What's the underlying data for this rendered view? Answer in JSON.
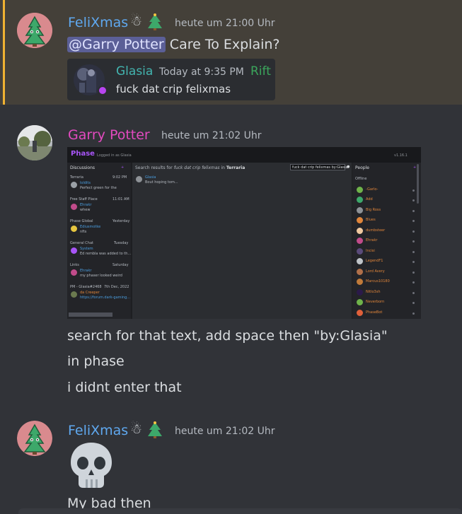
{
  "messages": [
    {
      "author": "FeliXmas",
      "author_color": "#5fa8ef",
      "emoji_icons": [
        "snowman-icon",
        "christmas-tree-icon"
      ],
      "timestamp": "heute um 21:00 Uhr",
      "mention": "@Garry Potter",
      "text": "Care To Explain?",
      "reply": {
        "author": "Glasia",
        "author_color": "#43b5b0",
        "timestamp": "Today at 9:35 PM",
        "tag": "Rift",
        "tag_color": "#3ba55c",
        "text": "fuck dat crip felixmas"
      }
    },
    {
      "author": "Garry Potter",
      "author_color": "#e34ac0",
      "timestamp": "heute um 21:02 Uhr",
      "lines": [
        "search for that text, add  space then \"by:Glasia\"",
        "in phase",
        "i didnt enter that"
      ],
      "attachment": {
        "app": "Phase",
        "logged_in": "Logged in as Glasia",
        "version": "v1.16.1",
        "discussions_label": "Discussions",
        "search_prefix": "Search results for",
        "search_query": "fuck dat crip felixmas",
        "search_in": "in",
        "search_server": "Terraria",
        "search_box": "fuck dat crip felixmas by:Glasia",
        "result_author": "Glasia",
        "result_text": "Bout hoping tom...",
        "people_label": "People",
        "offline_label": "Offline",
        "channels": [
          {
            "name": "Terraria",
            "time": "9:02 PM",
            "user": "loldits",
            "msg": "Perfect green for the"
          },
          {
            "name": "Free Staff Place",
            "time": "11:01 AM",
            "user": "Ehrakr",
            "msg": "whew"
          },
          {
            "name": "Phase Global",
            "time": "Yesterday",
            "user": "Ediusmotke",
            "msg": "nfts"
          },
          {
            "name": "General Chat",
            "time": "Tuesday",
            "user": "System",
            "msg": "Ed rembla was added to th..."
          },
          {
            "name": "Links",
            "time": "Saturday",
            "user": "Ehrakr",
            "msg": "my phaser looked weird"
          },
          {
            "name": "PM - Glasia#2468",
            "time": "7th Dec, 2022",
            "user": "da Creeper",
            "msg": "https://forum.dark-gaming..."
          }
        ],
        "people": [
          "-Garlo-",
          "Add",
          "Big Ross",
          "Blues",
          "dumbsteer",
          "Ehrakr",
          "Incisi",
          "LegendF1",
          "Lord Avery",
          "Marcus10180",
          "Nitlo3sh",
          "Neverborn",
          "PhaseBot"
        ]
      }
    },
    {
      "author": "FeliXmas",
      "author_color": "#5fa8ef",
      "emoji_icons": [
        "snowman-icon",
        "christmas-tree-icon"
      ],
      "timestamp": "heute um 21:02 Uhr",
      "emoji": "skull-icon",
      "text": "My bad then"
    }
  ]
}
